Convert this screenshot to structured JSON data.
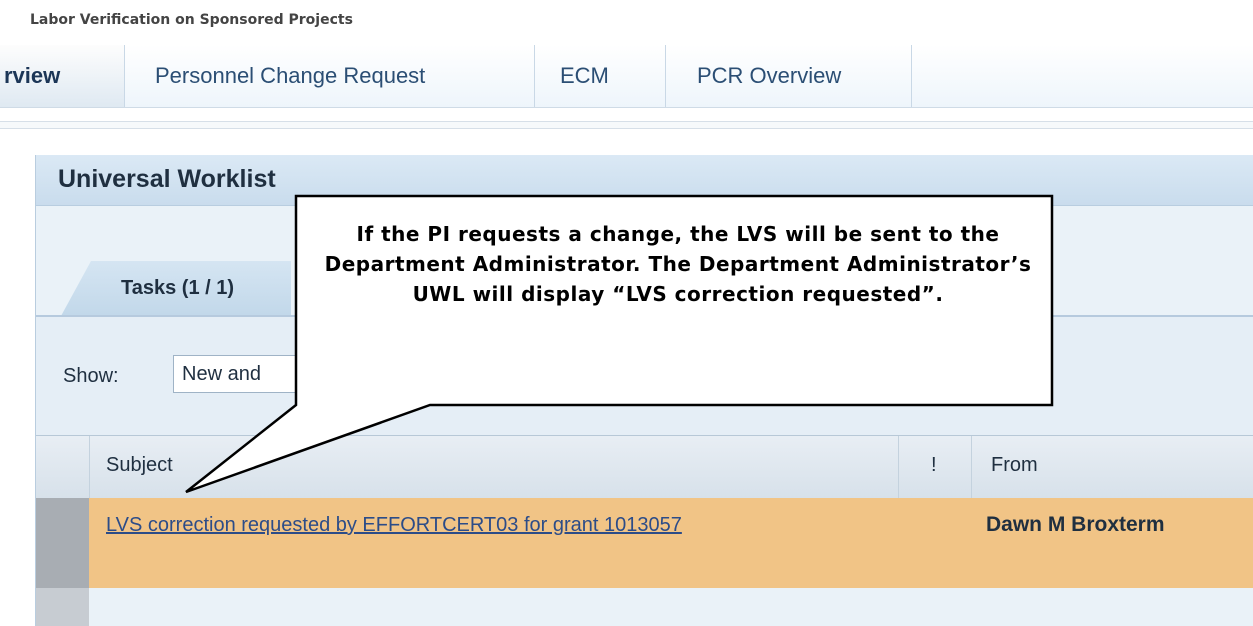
{
  "page": {
    "caption": "Labor Verification on Sponsored Projects"
  },
  "tabs": [
    {
      "label": "rview",
      "active": true
    },
    {
      "label": "Personnel Change Request",
      "active": false
    },
    {
      "label": "ECM",
      "active": false
    },
    {
      "label": "PCR Overview",
      "active": false
    }
  ],
  "uwl": {
    "title": "Universal Worklist",
    "tasks_tab_label": "Tasks (1 / 1)",
    "show_label": "Show:",
    "show_value": "New and"
  },
  "table": {
    "columns": {
      "subject": "Subject",
      "priority": "!",
      "from": "From"
    },
    "rows": [
      {
        "subject": "LVS correction requested by EFFORTCERT03 for grant 1013057",
        "from": "Dawn M Broxterm"
      }
    ]
  },
  "callout": {
    "text": "If the PI requests a change, the LVS will be sent to the Department Administrator.  The Department Administrator’s UWL will display “LVS correction requested”."
  },
  "colors": {
    "header_blue": "#c9dced",
    "highlight_row": "#f1c486",
    "link": "#2c4c88"
  }
}
